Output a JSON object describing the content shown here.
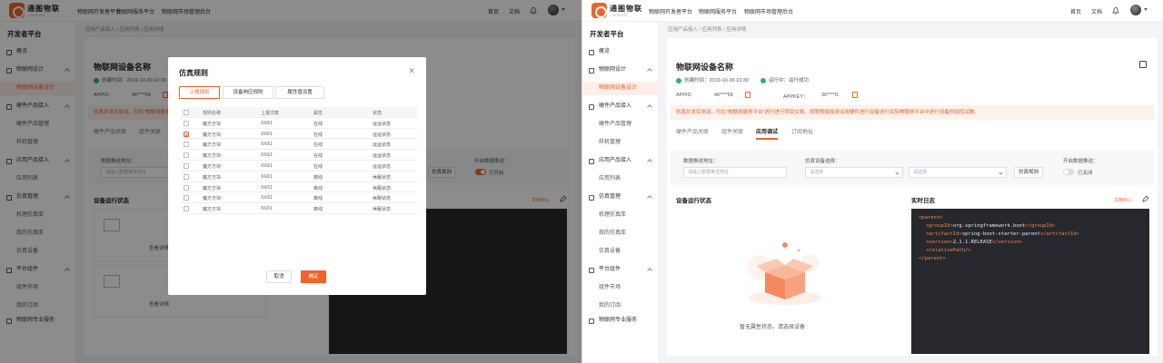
{
  "brand": {
    "name": "通图物联",
    "sub": "OCS IOT"
  },
  "topnav": [
    "物联网开发者平台",
    "物联网服务平台",
    "物联网市场管理后台"
  ],
  "topright": {
    "home": "首页",
    "docs": "文档"
  },
  "sidebar": {
    "title": "开发者平台",
    "items": [
      {
        "label": "概览",
        "type": "top",
        "icon": "home-icon"
      },
      {
        "label": "物联网设计",
        "type": "group",
        "icon": "design-icon"
      },
      {
        "label": "物联网设备设计",
        "type": "sub"
      },
      {
        "label": "硬件产品接入",
        "type": "group",
        "icon": "hardware-icon"
      },
      {
        "label": "硬件产品管理",
        "type": "sub"
      },
      {
        "label": "样机管理",
        "type": "sub"
      },
      {
        "label": "应用产品接入",
        "type": "group",
        "icon": "app-icon"
      },
      {
        "label": "应用列表",
        "type": "sub"
      },
      {
        "label": "仿真管理",
        "type": "group",
        "icon": "sim-icon"
      },
      {
        "label": "机理仿真库",
        "type": "sub"
      },
      {
        "label": "我的仿真库",
        "type": "sub"
      },
      {
        "label": "仿真设备",
        "type": "sub"
      },
      {
        "label": "平台组件",
        "type": "group",
        "icon": "component-icon"
      },
      {
        "label": "组件市场",
        "type": "sub"
      },
      {
        "label": "我的订阅",
        "type": "sub"
      },
      {
        "label": "物联网专业服务",
        "type": "group",
        "icon": "service-icon"
      }
    ]
  },
  "breadcrumb": [
    "应用产品接入",
    "应用列表",
    "应用详情"
  ],
  "detail": {
    "title": "物联网设备名称",
    "created_label": "创建时间：2019-10-30 10:30",
    "status_label": "运行中：运行成功",
    "appid_label": "APPID:",
    "appid_value": "46****58",
    "appkey_label": "APPKEY：",
    "appkey_value": "30****f1",
    "banner": "仿真并发实体设，可在\"物联网服务平台\"进行进行项目交易，按照预接接测试用硬件进行设备进行实际物联网平台中进行设备的调控试数。",
    "banner_left": "仿真并发实体设，可在\"物联网服务平台",
    "tabs": [
      "硬件产品关联",
      "组件关联",
      "应用调试",
      "订阅地址"
    ],
    "active_tab": 2
  },
  "filters": {
    "addr_label": "数据推送地址：",
    "addr_placeholder": "请输入数据推送地址",
    "sim_label": "仿真设备选择：",
    "sim_placeholder1": "请选择",
    "sim_placeholder2": "请选择",
    "sim_button": "仿真规则",
    "push_label": "开启数据推送：",
    "push_off": "已关闭",
    "push_on": "已开启"
  },
  "sections": {
    "status_title": "设备运行状态",
    "log_title": "实时日志",
    "doc_link": "文档中心",
    "empty_text": "暂无属性状态，请选择设备",
    "view_detail": "查看详情"
  },
  "log_lines": [
    {
      "indent": 0,
      "open": "<parent>",
      "text": "",
      "close": ""
    },
    {
      "indent": 1,
      "open": "<groupId>",
      "text": "org.springframework.boot",
      "close": "</groupId>"
    },
    {
      "indent": 1,
      "open": "<artifactId>",
      "text": "spring-boot-starter-parent",
      "close": "</artifactId>"
    },
    {
      "indent": 1,
      "open": "<version>",
      "text": "2.1.1.RELEASE",
      "close": "</version>"
    },
    {
      "indent": 1,
      "open": "<relativePath/>",
      "text": "",
      "close": ""
    },
    {
      "indent": 0,
      "open": "</parent>",
      "text": "",
      "close": ""
    }
  ],
  "log_left_fragments": [
    ">",
    "</groupId>",
    "-parent</artifactId>",
    "</version>"
  ],
  "modal": {
    "title": "仿真规则",
    "tabs": [
      "上报规则",
      "设备响应规则",
      "属性值设置"
    ],
    "columns": [
      "规则名称",
      "上报次数",
      "属性",
      "状态"
    ],
    "rows": [
      {
        "name": "魔方方块",
        "count": "XXX1",
        "attr": "在线",
        "status": "运运状态",
        "checked": false
      },
      {
        "name": "魔方方块",
        "count": "XXX1",
        "attr": "在线",
        "status": "运运状态",
        "checked": true
      },
      {
        "name": "魔方方块",
        "count": "XXX1",
        "attr": "在线",
        "status": "运运状态",
        "checked": false
      },
      {
        "name": "魔方方块",
        "count": "XXX1",
        "attr": "在线",
        "status": "运运状态",
        "checked": false
      },
      {
        "name": "魔方方块",
        "count": "XXX1",
        "attr": "在线",
        "status": "运运状态",
        "checked": false
      },
      {
        "name": "魔方方块",
        "count": "XXX1",
        "attr": "离线",
        "status": "休眠状态",
        "checked": false
      },
      {
        "name": "魔方方块",
        "count": "XXX1",
        "attr": "离线",
        "status": "休眠状态",
        "checked": false
      },
      {
        "name": "魔方方块",
        "count": "XXX1",
        "attr": "离线",
        "status": "休眠状态",
        "checked": false
      },
      {
        "name": "魔方方块",
        "count": "XXX1",
        "attr": "离线",
        "status": "休眠状态",
        "checked": false
      }
    ],
    "cancel": "取消",
    "confirm": "确定"
  },
  "colors": {
    "accent": "#f0632a",
    "success": "#2fb36b",
    "log_bg": "#26282d"
  }
}
